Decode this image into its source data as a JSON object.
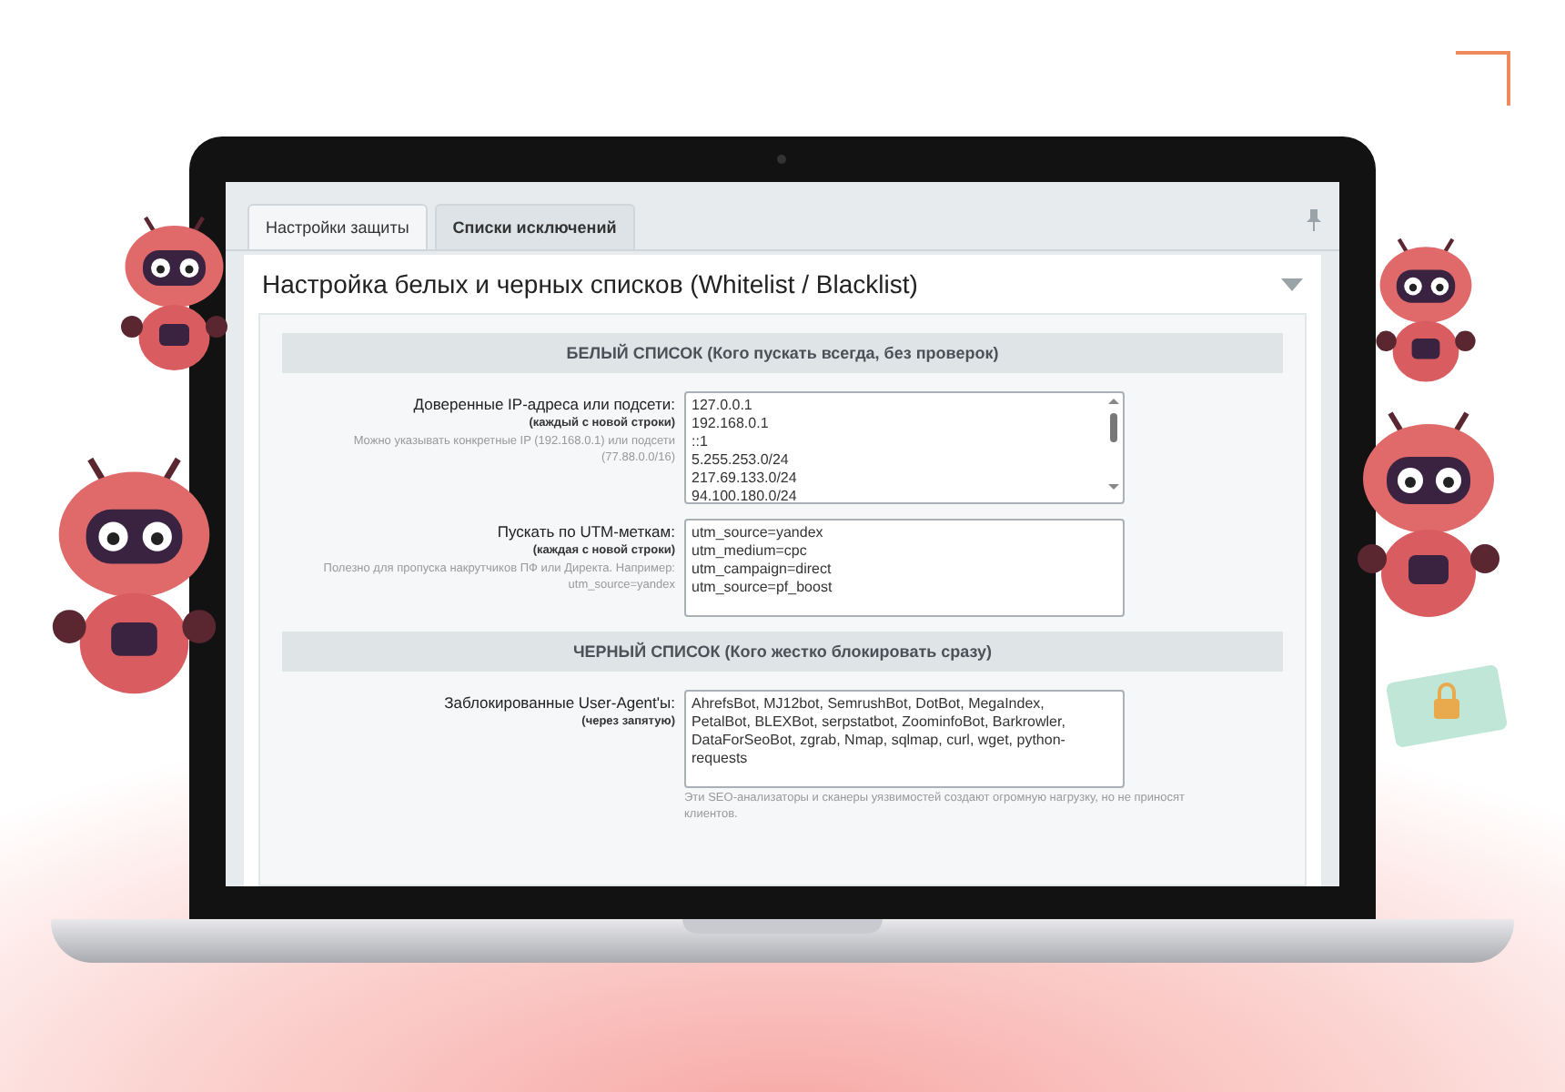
{
  "tabs": [
    {
      "label": "Настройки защиты",
      "selected": false
    },
    {
      "label": "Списки исключений",
      "selected": true
    }
  ],
  "panel": {
    "title": "Настройка белых и черных списков (Whitelist / Blacklist)",
    "expanded": true
  },
  "sections": [
    {
      "title": "БЕЛЫЙ СПИСОК (Кого пускать всегда, без проверок)",
      "fields": [
        {
          "label": "Доверенные IP-адреса или подсети:",
          "hint": "(каждый с новой строки)",
          "description": "Можно указывать конкретные IP (192.168.0.1) или подсети (77.88.0.0/16)",
          "value": "127.0.0.1\n192.168.0.1\n::1\n5.255.253.0/24\n217.69.133.0/24\n94.100.180.0/24",
          "scrollbar": true
        },
        {
          "label": "Пускать по UTM-меткам:",
          "hint": "(каждая с новой строки)",
          "description": "Полезно для пропуска накрутчиков ПФ или Директа. Например: utm_source=yandex",
          "value": "utm_source=yandex\nutm_medium=cpc\nutm_campaign=direct\nutm_source=pf_boost",
          "scrollbar": false
        }
      ]
    },
    {
      "title": "ЧЕРНЫЙ СПИСОК (Кого жестко блокировать сразу)",
      "fields": [
        {
          "label": "Заблокированные User-Agent'ы:",
          "hint": "(через запятую)",
          "value": "AhrefsBot, MJ12bot, SemrushBot, DotBot, MegaIndex, PetalBot, BLEXBot, serpstatbot, ZoominfoBot, Barkrowler, DataForSeoBot, zgrab, Nmap, sqlmap, curl, wget, python-requests",
          "note": "Эти SEO-анализаторы и сканеры уязвимостей создают огромную нагрузку, но не приносят клиентов.",
          "scrollbar": false
        }
      ]
    }
  ]
}
